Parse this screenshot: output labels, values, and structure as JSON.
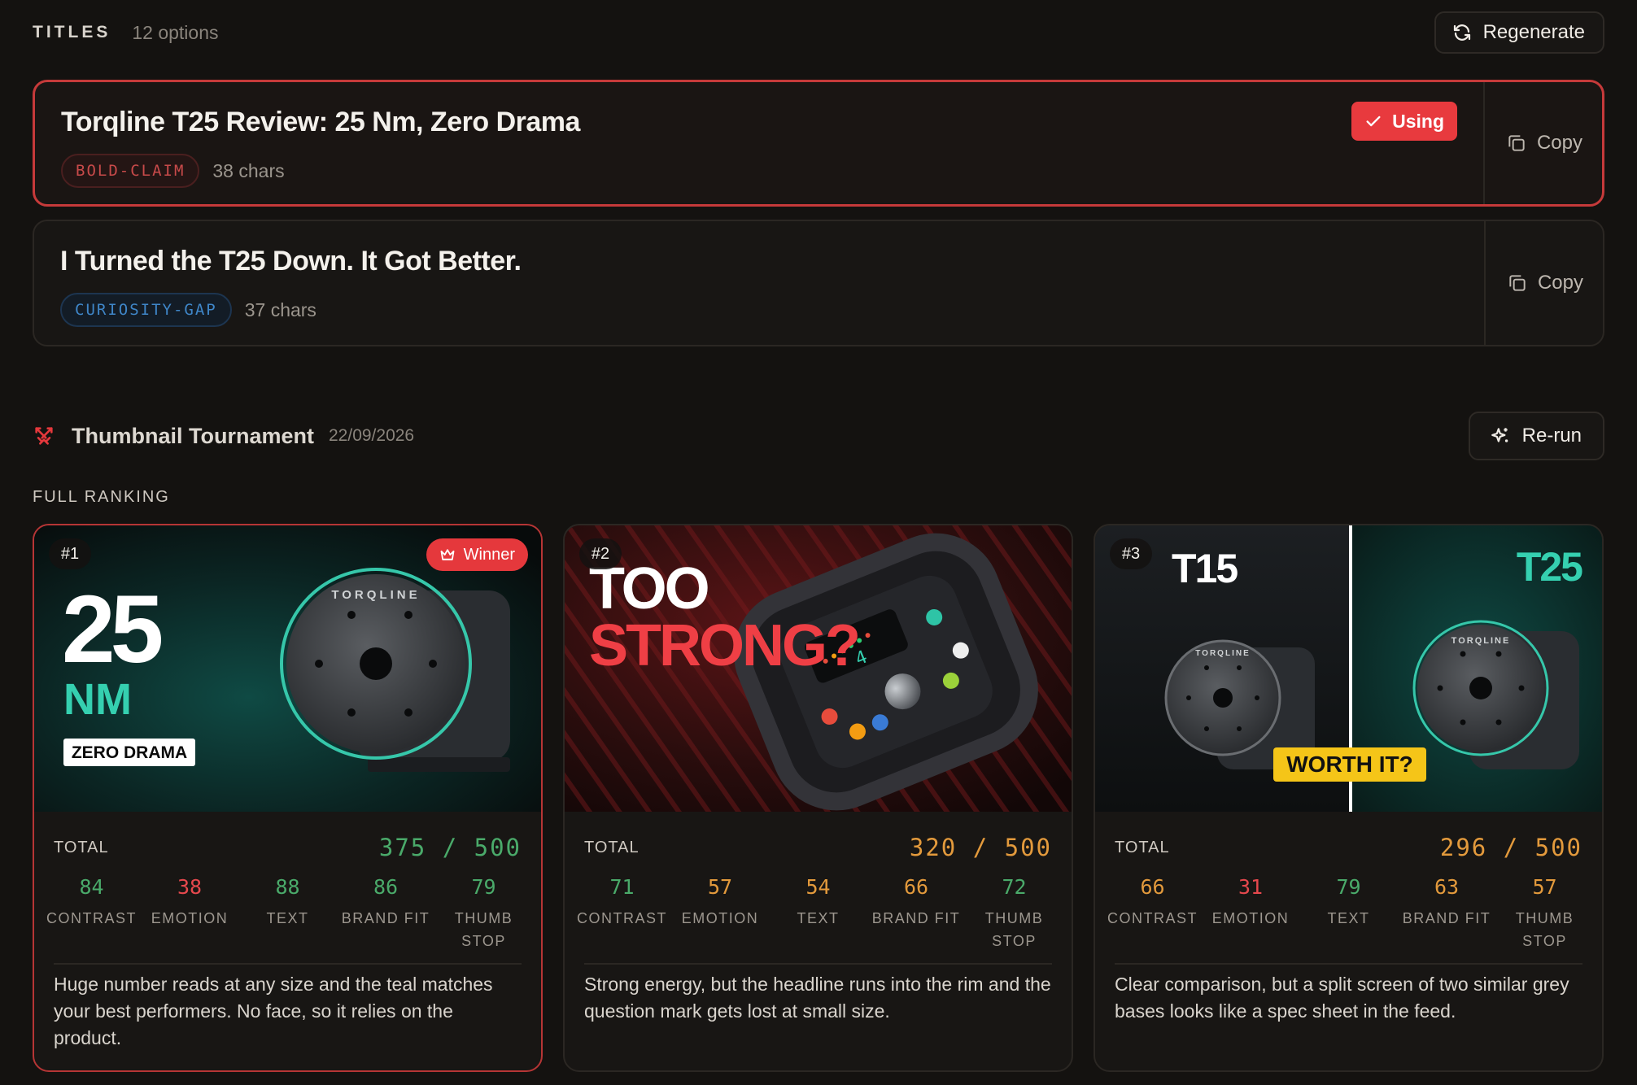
{
  "titles": {
    "label": "TITLES",
    "count": "12 options",
    "regenerate_label": "Regenerate",
    "options": [
      {
        "title": "Torqline T25 Review: 25 Nm, Zero Drama",
        "tag": "BOLD-CLAIM",
        "chars": "38 chars",
        "using_label": "Using",
        "copy_label": "Copy"
      },
      {
        "title": "I Turned the T25 Down. It Got Better.",
        "tag": "CURIOSITY-GAP",
        "chars": "37 chars",
        "copy_label": "Copy"
      }
    ]
  },
  "tournament": {
    "title": "Thumbnail Tournament",
    "date": "22/09/2026",
    "rerun_label": "Re-run",
    "section_label": "FULL RANKING",
    "total_label": "TOTAL",
    "cards": [
      {
        "rank": "#1",
        "winner_label": "Winner",
        "total": "375 / 500",
        "thumb": {
          "big": "25",
          "unit": "NM",
          "box": "ZERO DRAMA",
          "brand": "TORQLINE"
        },
        "metrics": [
          {
            "value": "84",
            "label": "CONTRAST"
          },
          {
            "value": "38",
            "label": "EMOTION"
          },
          {
            "value": "88",
            "label": "TEXT"
          },
          {
            "value": "86",
            "label": "BRAND FIT"
          },
          {
            "value": "79",
            "label": "THUMB STOP"
          }
        ],
        "summary": "Huge number reads at any size and the teal matches your best performers. No face, so it relies on the product."
      },
      {
        "rank": "#2",
        "total": "320 / 500",
        "thumb": {
          "line1": "TOO",
          "line2": "STRONG?",
          "display": "4"
        },
        "metrics": [
          {
            "value": "71",
            "label": "CONTRAST"
          },
          {
            "value": "57",
            "label": "EMOTION"
          },
          {
            "value": "54",
            "label": "TEXT"
          },
          {
            "value": "66",
            "label": "BRAND FIT"
          },
          {
            "value": "72",
            "label": "THUMB STOP"
          }
        ],
        "summary": "Strong energy, but the headline runs into the rim and the question mark gets lost at small size."
      },
      {
        "rank": "#3",
        "total": "296 / 500",
        "thumb": {
          "left": "T15",
          "right": "T25",
          "banner": "WORTH IT?",
          "brand": "TORQLINE"
        },
        "metrics": [
          {
            "value": "66",
            "label": "CONTRAST"
          },
          {
            "value": "31",
            "label": "EMOTION"
          },
          {
            "value": "79",
            "label": "TEXT"
          },
          {
            "value": "63",
            "label": "BRAND FIT"
          },
          {
            "value": "57",
            "label": "THUMB STOP"
          }
        ],
        "summary": "Clear comparison, but a split screen of two similar grey bases looks like a spec sheet in the feed."
      }
    ]
  },
  "colors": {
    "accent_red": "#e5383c",
    "teal": "#2ec4a6",
    "score_green": "#4aaa6a",
    "score_orange": "#e39a3c",
    "score_red": "#e5484d"
  },
  "icons": [
    "refresh-icon",
    "check-icon",
    "copy-icon",
    "swords-icon",
    "sparkle-icon",
    "crown-icon"
  ]
}
